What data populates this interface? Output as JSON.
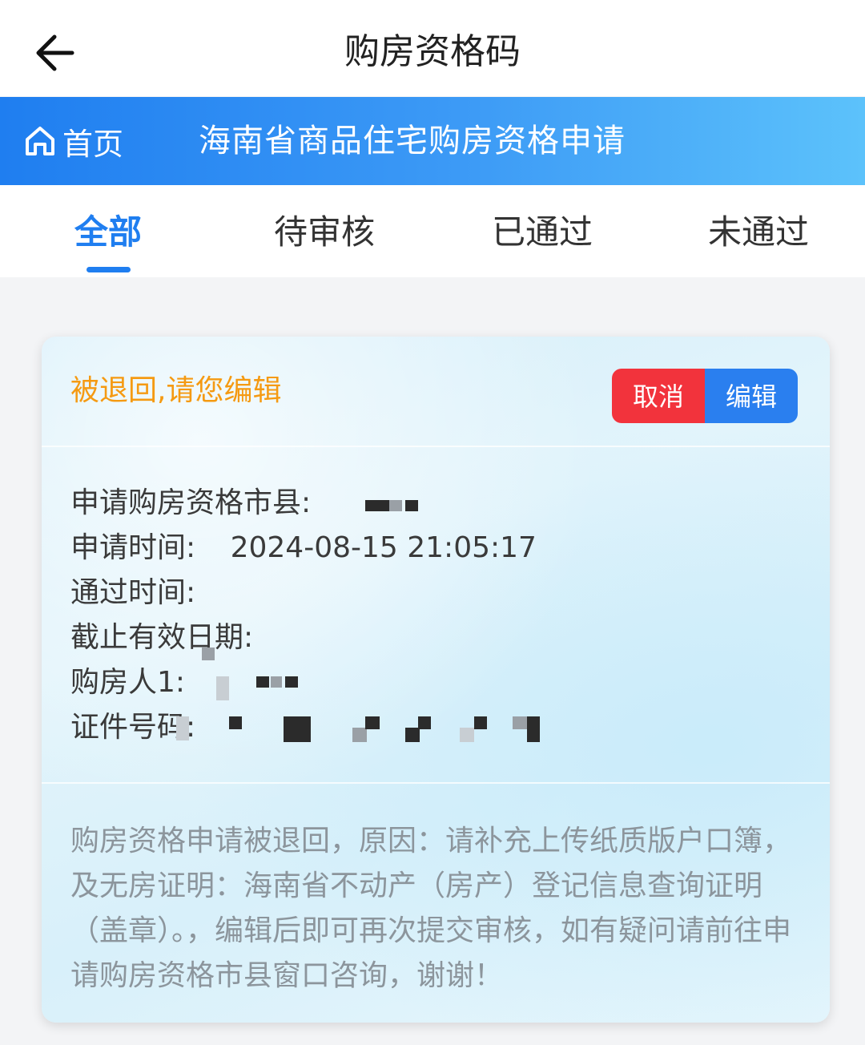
{
  "header": {
    "title": "购房资格码",
    "back_icon": "arrow-left-icon"
  },
  "banner": {
    "home_label": "首页",
    "home_icon": "home-icon",
    "title": "海南省商品住宅购房资格申请",
    "colors": [
      "#1f7ef0",
      "#5cc2fb"
    ]
  },
  "tabs": [
    {
      "label": "全部",
      "active": true
    },
    {
      "label": "待审核",
      "active": false
    },
    {
      "label": "已通过",
      "active": false
    },
    {
      "label": "未通过",
      "active": false
    }
  ],
  "card": {
    "status": "被退回,请您编辑",
    "status_color": "#f59a12",
    "cancel_label": "取消",
    "edit_label": "编辑",
    "fields": [
      {
        "label": "申请购房资格市县:",
        "value": ""
      },
      {
        "label": "申请时间:",
        "value": "2024-08-15 21:05:17"
      },
      {
        "label": "通过时间:",
        "value": ""
      },
      {
        "label": "截止有效日期:",
        "value": ""
      },
      {
        "label": "购房人1:",
        "value": ""
      },
      {
        "label": "证件号码:",
        "value": ""
      }
    ],
    "reason": "购房资格申请被退回，原因：请补充上传纸质版户口簿，及无房证明：海南省不动产（房产）登记信息查询证明（盖章）。，编辑后即可再次提交审核，如有疑问请前往申请购房资格市县窗口咨询，谢谢！"
  },
  "colors": {
    "accent": "#1f7ef0",
    "danger": "#f2333c",
    "primary_button": "#2a7fef"
  }
}
